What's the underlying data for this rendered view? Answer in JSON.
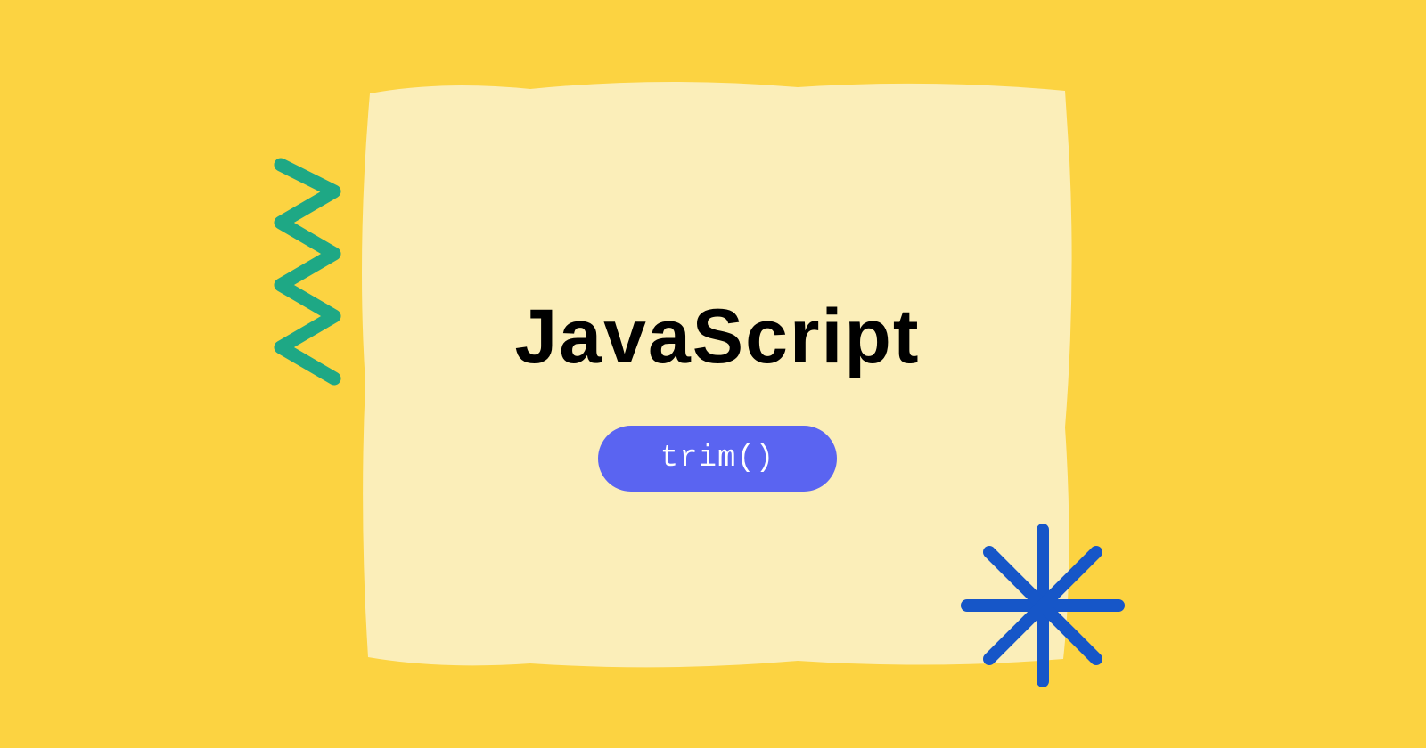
{
  "title": "JavaScript",
  "badge_label": "trim()",
  "colors": {
    "background": "#fcd341",
    "card": "#fbeeb9",
    "title": "#000000",
    "badge_bg": "#5a64f1",
    "badge_text": "#ffffff",
    "zigzag": "#1ea885",
    "asterisk": "#1656c8"
  },
  "decorations": {
    "zigzag_icon": "zigzag",
    "asterisk_icon": "asterisk"
  }
}
